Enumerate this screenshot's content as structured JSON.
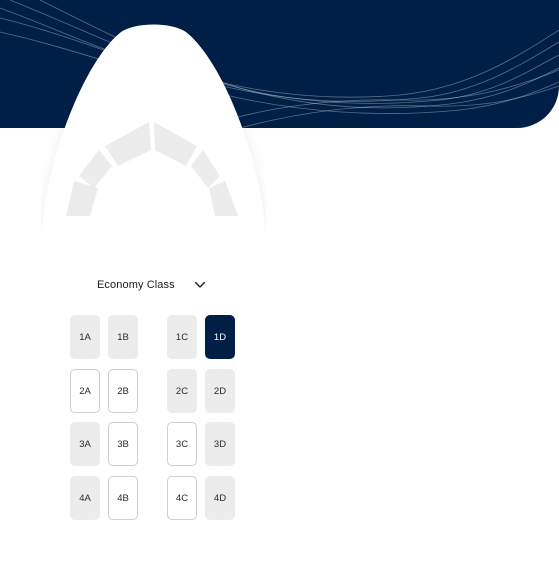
{
  "colors": {
    "navy": "#001f47",
    "seat_taken": "#ececec",
    "seat_available_border": "#cfcfcf",
    "selected_text": "#ffffff"
  },
  "cabin_selector": {
    "label": "Economy Class",
    "icon": "chevron-down-icon"
  },
  "seats": [
    {
      "id": "1A",
      "status": "taken"
    },
    {
      "id": "1B",
      "status": "taken"
    },
    {
      "id": "1C",
      "status": "taken"
    },
    {
      "id": "1D",
      "status": "selected"
    },
    {
      "id": "2A",
      "status": "available"
    },
    {
      "id": "2B",
      "status": "available"
    },
    {
      "id": "2C",
      "status": "taken"
    },
    {
      "id": "2D",
      "status": "taken"
    },
    {
      "id": "3A",
      "status": "taken"
    },
    {
      "id": "3B",
      "status": "available"
    },
    {
      "id": "3C",
      "status": "available"
    },
    {
      "id": "3D",
      "status": "taken"
    },
    {
      "id": "4A",
      "status": "taken"
    },
    {
      "id": "4B",
      "status": "available"
    },
    {
      "id": "4C",
      "status": "available"
    },
    {
      "id": "4D",
      "status": "taken"
    }
  ]
}
